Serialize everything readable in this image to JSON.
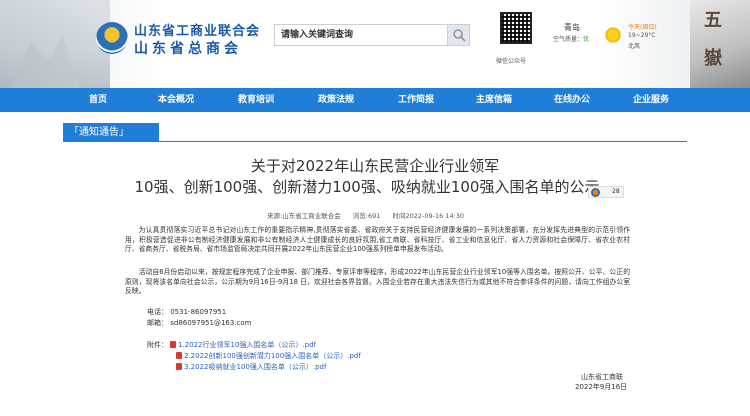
{
  "header": {
    "org_name_line1": "山东省工商业联合会",
    "org_name_line2": "山东省总商会",
    "search": {
      "placeholder": "请输入关键词查询"
    },
    "qr_caption": "微信公众号",
    "weather": {
      "city": "青岛",
      "air_label": "空气质量：",
      "air_value": "优",
      "today": "今天(周日)",
      "temp": "19~29°C",
      "wind": "北风"
    },
    "stone_chars": [
      "五",
      "嶽"
    ]
  },
  "nav": {
    "items": [
      "首页",
      "本会概况",
      "教育培训",
      "政策法规",
      "工作简报",
      "主席信箱",
      "在线办公",
      "企业服务"
    ]
  },
  "section": {
    "label": "「通知通告」"
  },
  "article": {
    "title_line1": "关于对2022年山东民营企业行业领军",
    "title_line2": "10强、创新100强、创新潜力100强、吸纳就业100强入围名单的公示",
    "share_count": "28",
    "meta": {
      "source": "来源:山东省工商业联合会",
      "views": "浏览:691",
      "time": "时间2022-09-16 14:30"
    },
    "paragraphs": [
      "为认真贯彻落实习近平总书记对山东工作的重要指示精神,贯彻落实省委、省政府关于支持民营经济健康发展的一系列决策部署，充分发挥先进典型的示范引领作用，积极营造促进非公有制经济健康发展和非公有制经济人士健康成长的良好氛围,省工商联、省科技厅、省工业和信息化厅、省人力资源和社会保障厅、省农业农村厅、省商务厅、省税务局、省市场监管局决定共同开展2022年山东民营企业100强系列榜单申报发布活动。",
      "活动自6月份启动以来，按规定程序完成了企业申报、部门推荐、专家评审等程序，形成2022年山东民营企业行业领军10强等入围名单。按照公开、公平、公正的原则，现将该名单向社会公示，公示期为9月16日-9月18 日，欢迎社会各界监督。入围企业若存在重大违法失信行为或其他不符合参评条件的问题，请向工作组办公室反映。"
    ],
    "contact": {
      "phone": "电话：  0531-86097951",
      "email": "邮箱：  sd86097951@163.com"
    },
    "attachments_label": "附件：",
    "attachments": [
      "1.2022行业领军10强入围名单（公示）.pdf",
      "2.2022创新100强创新潜力100强入围名单（公示）.pdf",
      "3.2022吸纳就业100强入围名单（公示）.pdf"
    ],
    "signature": {
      "org": "山东省工商联",
      "date": "2022年9月16日"
    }
  }
}
